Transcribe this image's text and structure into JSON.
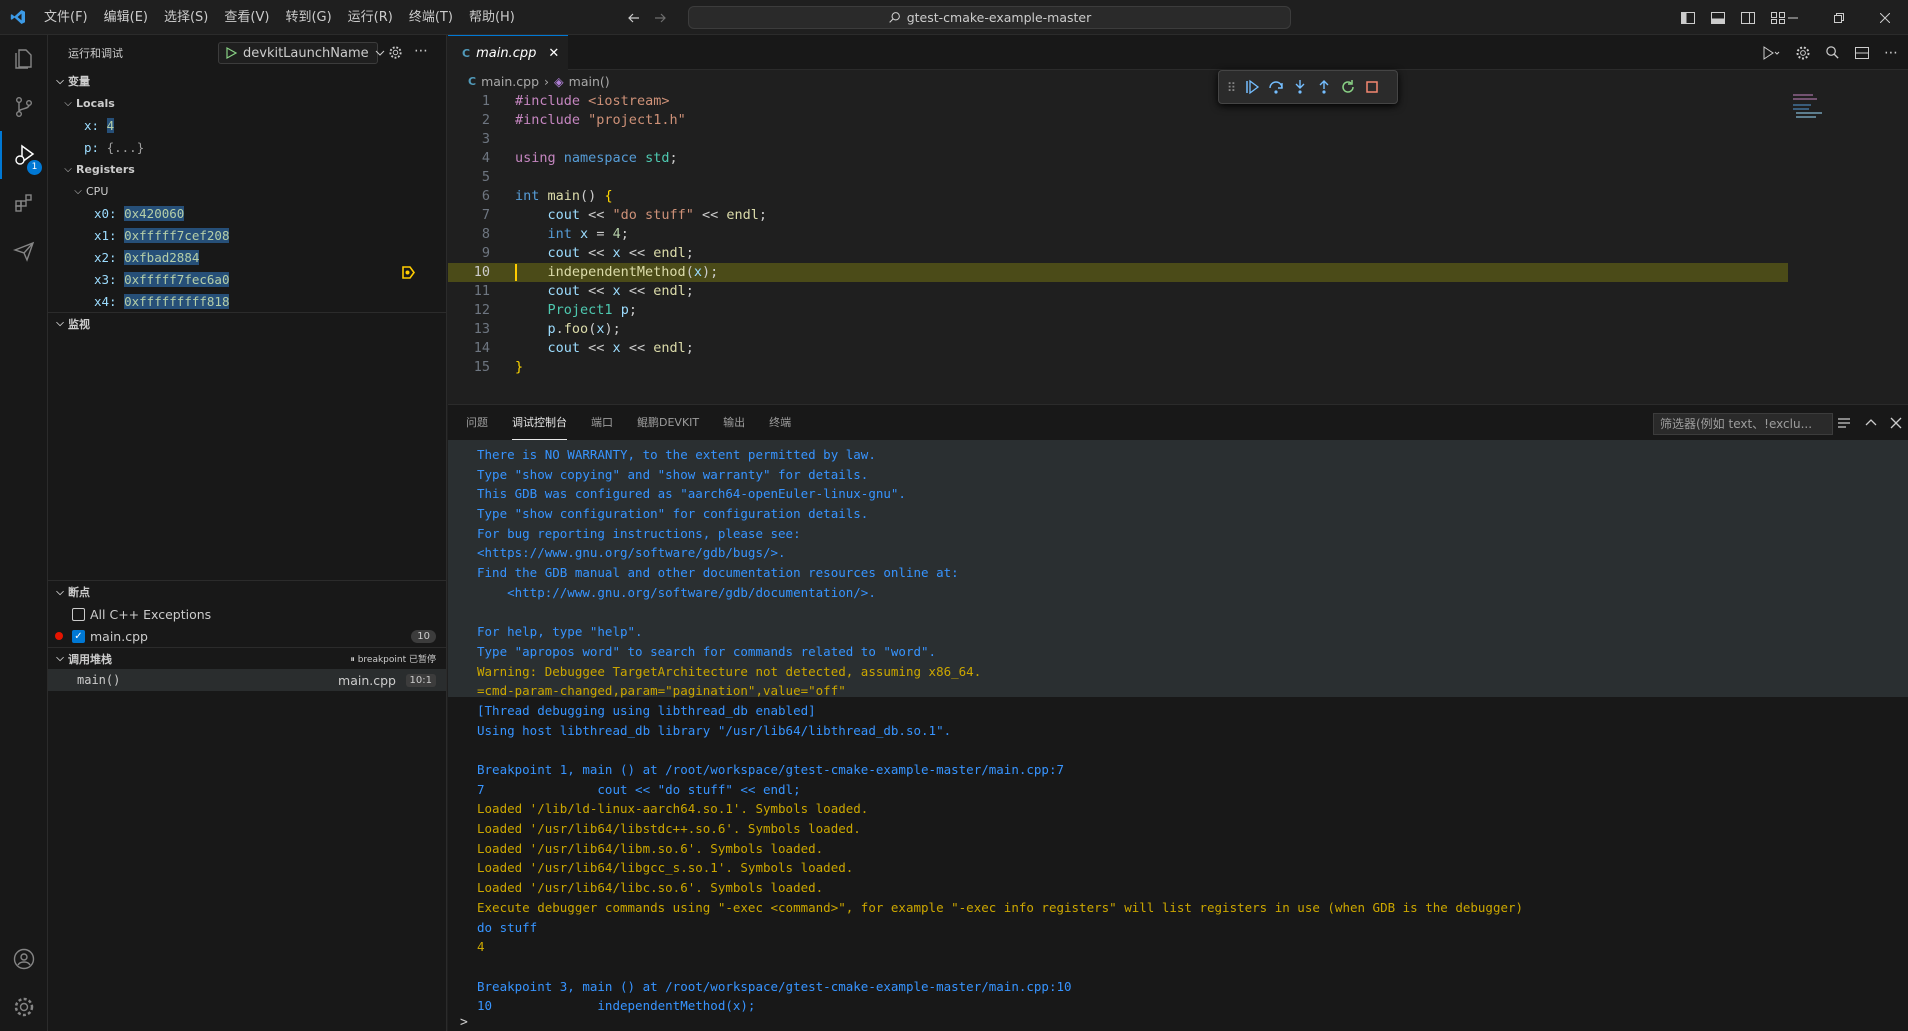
{
  "titlebar": {
    "menus": [
      "文件(F)",
      "编辑(E)",
      "选择(S)",
      "查看(V)",
      "转到(G)",
      "运行(R)",
      "终端(T)",
      "帮助(H)"
    ],
    "search_text": "gtest-cmake-example-master"
  },
  "activity": {
    "debug_badge": "1"
  },
  "sidebar": {
    "title": "运行和调试",
    "launch_config": "devkitLaunchName",
    "variables_header": "变量",
    "locals_label": "Locals",
    "locals": [
      {
        "name": "x:",
        "value": "4"
      },
      {
        "name": "p:",
        "value": "{...}"
      }
    ],
    "registers_label": "Registers",
    "cpu_label": "CPU",
    "registers": [
      {
        "name": "x0:",
        "value": "0x420060"
      },
      {
        "name": "x1:",
        "value": "0xfffff7cef208"
      },
      {
        "name": "x2:",
        "value": "0xfbad2884"
      },
      {
        "name": "x3:",
        "value": "0xfffff7fec6a0"
      },
      {
        "name": "x4:",
        "value": "0xfffffffff818"
      }
    ],
    "watch_header": "监视",
    "breakpoints_header": "断点",
    "breakpoints": [
      {
        "label": "All C++ Exceptions",
        "checked": false
      },
      {
        "label": "main.cpp",
        "checked": true,
        "count": "10"
      }
    ],
    "callstack_header": "调用堆栈",
    "callstack_status": "breakpoint 已暂停",
    "callstack_frames": [
      {
        "fn": "main()",
        "file": "main.cpp",
        "pos": "10:1"
      }
    ]
  },
  "editor": {
    "tab_label": "main.cpp",
    "breadcrumb_file": "main.cpp",
    "breadcrumb_symbol": "main()",
    "current_line": 10,
    "lines": [
      {
        "n": "1",
        "html": "<span class='inc'>#include</span> <span class='str'>&lt;iostream&gt;</span>"
      },
      {
        "n": "2",
        "html": "<span class='inc'>#include</span> <span class='str'>\"project1.h\"</span>"
      },
      {
        "n": "3",
        "html": ""
      },
      {
        "n": "4",
        "html": "<span class='inc'>using</span> <span class='kw'>namespace</span> <span class='ty'>std</span>;"
      },
      {
        "n": "5",
        "html": ""
      },
      {
        "n": "6",
        "html": "<span class='kw'>int</span> <span class='fn'>main</span>() <span style='color:#ffd700'>{</span>"
      },
      {
        "n": "7",
        "html": "    <span class='var'>cout</span> &lt;&lt; <span class='str'>\"do stuff\"</span> &lt;&lt; <span class='fn'>endl</span>;"
      },
      {
        "n": "8",
        "html": "    <span class='kw'>int</span> <span class='var'>x</span> = <span class='num'>4</span>;"
      },
      {
        "n": "9",
        "html": "    <span class='var'>cout</span> &lt;&lt; <span class='var'>x</span> &lt;&lt; <span class='fn'>endl</span>;"
      },
      {
        "n": "10",
        "html": "    <span class='fn'>independentMethod</span>(<span class='var'>x</span>);"
      },
      {
        "n": "11",
        "html": "    <span class='var'>cout</span> &lt;&lt; <span class='var'>x</span> &lt;&lt; <span class='fn'>endl</span>;"
      },
      {
        "n": "12",
        "html": "    <span class='ty'>Project1</span> <span class='var'>p</span>;"
      },
      {
        "n": "13",
        "html": "    <span class='var'>p</span>.<span class='fn'>foo</span>(<span class='var'>x</span>);"
      },
      {
        "n": "14",
        "html": "    <span class='var'>cout</span> &lt;&lt; <span class='var'>x</span> &lt;&lt; <span class='fn'>endl</span>;"
      },
      {
        "n": "15",
        "html": "<span style='color:#ffd700'>}</span>"
      }
    ]
  },
  "panel": {
    "tabs": [
      "问题",
      "调试控制台",
      "端口",
      "鲲鹏DEVKIT",
      "输出",
      "终端"
    ],
    "active_tab": 1,
    "filter_placeholder": "筛选器(例如 text、!exclu...",
    "console_lines": [
      {
        "t": "There is NO WARRANTY, to the extent permitted by law.",
        "c": "blue"
      },
      {
        "t": "Type \"show copying\" and \"show warranty\" for details.",
        "c": "blue"
      },
      {
        "t": "This GDB was configured as \"aarch64-openEuler-linux-gnu\".",
        "c": "blue"
      },
      {
        "t": "Type \"show configuration\" for configuration details.",
        "c": "blue"
      },
      {
        "t": "For bug reporting instructions, please see:",
        "c": "blue"
      },
      {
        "t": "<https://www.gnu.org/software/gdb/bugs/>.",
        "c": "blue"
      },
      {
        "t": "Find the GDB manual and other documentation resources online at:",
        "c": "blue"
      },
      {
        "t": "    <http://www.gnu.org/software/gdb/documentation/>.",
        "c": "blue"
      },
      {
        "t": "",
        "c": "blue"
      },
      {
        "t": "For help, type \"help\".",
        "c": "blue"
      },
      {
        "t": "Type \"apropos word\" to search for commands related to \"word\".",
        "c": "blue"
      },
      {
        "t": "Warning: Debuggee TargetArchitecture not detected, assuming x86_64.",
        "c": "or"
      },
      {
        "t": "=cmd-param-changed,param=\"pagination\",value=\"off\"",
        "c": "or"
      },
      {
        "t": "[Thread debugging using libthread_db enabled]",
        "c": "blue"
      },
      {
        "t": "Using host libthread_db library \"/usr/lib64/libthread_db.so.1\".",
        "c": "blue"
      },
      {
        "t": "",
        "c": "blue"
      },
      {
        "t": "Breakpoint 1, main () at /root/workspace/gtest-cmake-example-master/main.cpp:7",
        "c": "blue"
      },
      {
        "t": "7               cout << \"do stuff\" << endl;",
        "c": "blue"
      },
      {
        "t": "Loaded '/lib/ld-linux-aarch64.so.1'. Symbols loaded.",
        "c": "or"
      },
      {
        "t": "Loaded '/usr/lib64/libstdc++.so.6'. Symbols loaded.",
        "c": "or"
      },
      {
        "t": "Loaded '/usr/lib64/libm.so.6'. Symbols loaded.",
        "c": "or"
      },
      {
        "t": "Loaded '/usr/lib64/libgcc_s.so.1'. Symbols loaded.",
        "c": "or"
      },
      {
        "t": "Loaded '/usr/lib64/libc.so.6'. Symbols loaded.",
        "c": "or"
      },
      {
        "t": "Execute debugger commands using \"-exec <command>\", for example \"-exec info registers\" will list registers in use (when GDB is the debugger)",
        "c": "or"
      },
      {
        "t": "do stuff",
        "c": "blue"
      },
      {
        "t": "4",
        "c": "or"
      },
      {
        "t": "",
        "c": "blue"
      },
      {
        "t": "Breakpoint 3, main () at /root/workspace/gtest-cmake-example-master/main.cpp:10",
        "c": "blue"
      },
      {
        "t": "10              independentMethod(x);",
        "c": "blue"
      }
    ],
    "prompt": ">"
  }
}
